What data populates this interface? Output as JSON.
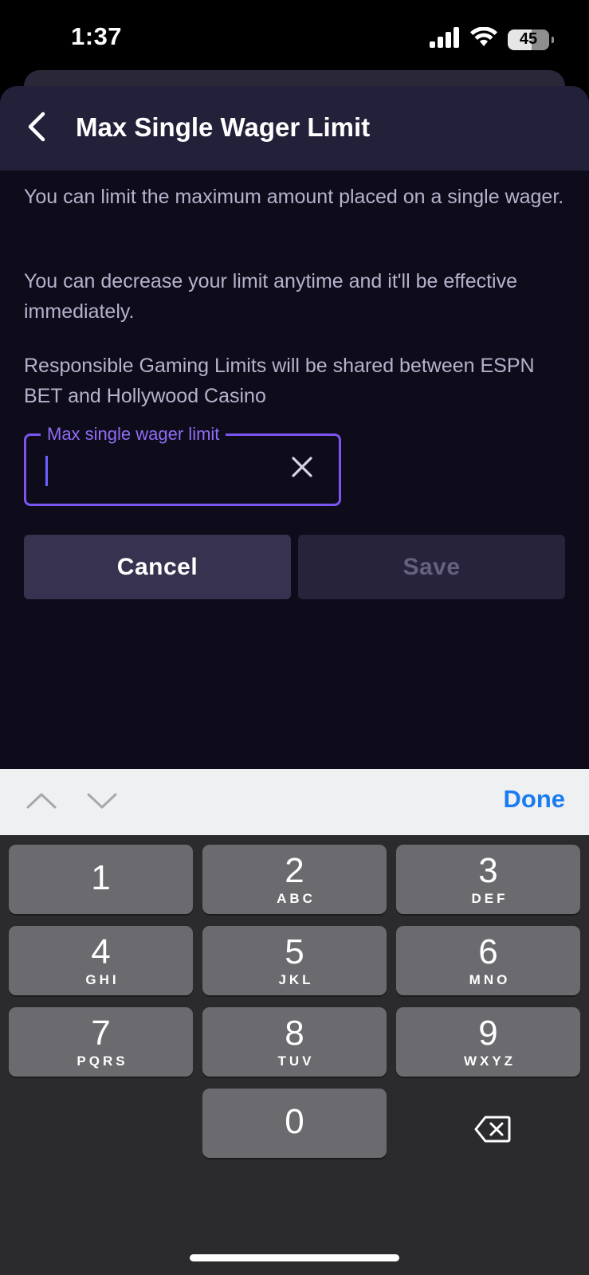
{
  "status_bar": {
    "time": "1:37",
    "battery": "45"
  },
  "sheet": {
    "title": "Max Single Wager Limit",
    "paragraphs": [
      "You can limit the maximum amount placed on a single wager.",
      "You can decrease your limit anytime and it'll be effective immediately.",
      "Responsible Gaming Limits will be shared between ESPN BET and Hollywood Casino"
    ],
    "field": {
      "label": "Max single wager limit",
      "value": ""
    },
    "buttons": {
      "cancel": "Cancel",
      "save": "Save"
    }
  },
  "accessory": {
    "done": "Done"
  },
  "keyboard": {
    "keys": [
      {
        "num": "1",
        "letters": ""
      },
      {
        "num": "2",
        "letters": "ABC"
      },
      {
        "num": "3",
        "letters": "DEF"
      },
      {
        "num": "4",
        "letters": "GHI"
      },
      {
        "num": "5",
        "letters": "JKL"
      },
      {
        "num": "6",
        "letters": "MNO"
      },
      {
        "num": "7",
        "letters": "PQRS"
      },
      {
        "num": "8",
        "letters": "TUV"
      },
      {
        "num": "9",
        "letters": "WXYZ"
      },
      {
        "num": "0",
        "letters": ""
      }
    ]
  },
  "colors": {
    "accent": "#7b55f0",
    "done_blue": "#1a7cf0",
    "sheet_bg": "#0e0c1a",
    "header_bg": "#23213a"
  }
}
